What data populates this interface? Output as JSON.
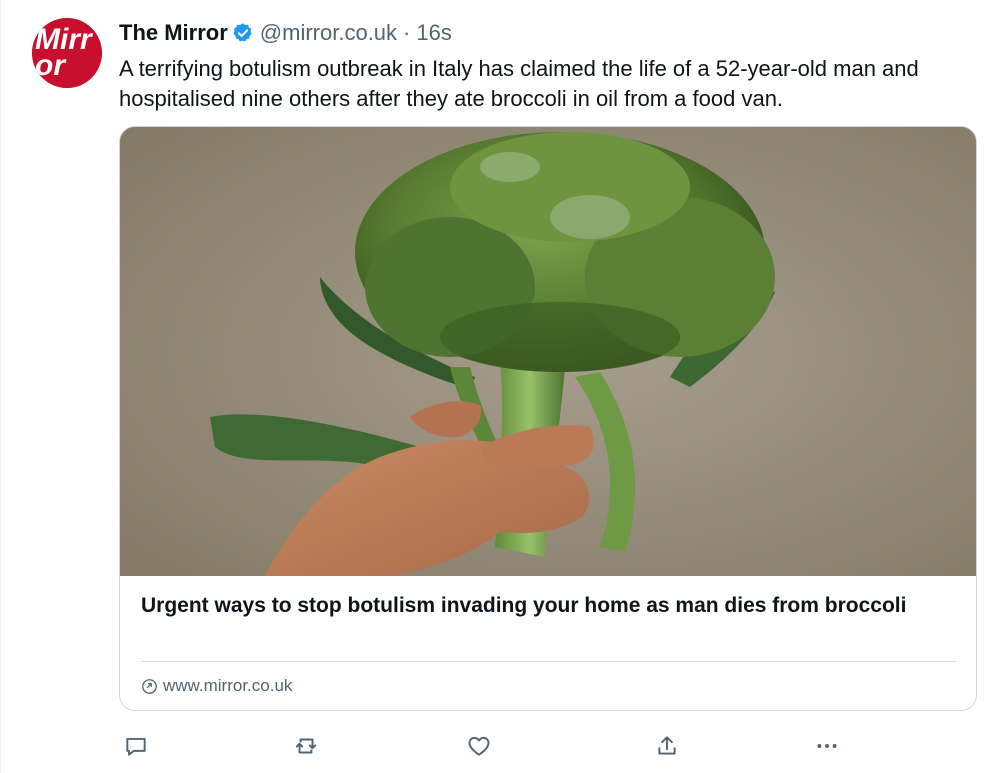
{
  "post": {
    "author": {
      "display_name": "The Mirror",
      "handle": "@mirror.co.uk",
      "separator": "·",
      "time": "16s",
      "avatar_text": "Mirror",
      "avatar_color": "#c8102e",
      "verified_color": "#1d9bf0"
    },
    "text": "A terrifying botulism outbreak in Italy has claimed the life of a 52-year-old man and hospitalised nine others after they ate broccoli in oil from a food van.",
    "card": {
      "image_alt": "A hand holding a head of broccoli against a beige background",
      "title": "Urgent ways to stop botulism invading your home as man dies from broccoli",
      "domain": "www.mirror.co.uk"
    },
    "actions": [
      {
        "name": "reply",
        "icon": "reply-icon"
      },
      {
        "name": "repost",
        "icon": "repost-icon"
      },
      {
        "name": "like",
        "icon": "heart-icon"
      },
      {
        "name": "share",
        "icon": "share-icon"
      },
      {
        "name": "more",
        "icon": "more-icon"
      }
    ]
  }
}
